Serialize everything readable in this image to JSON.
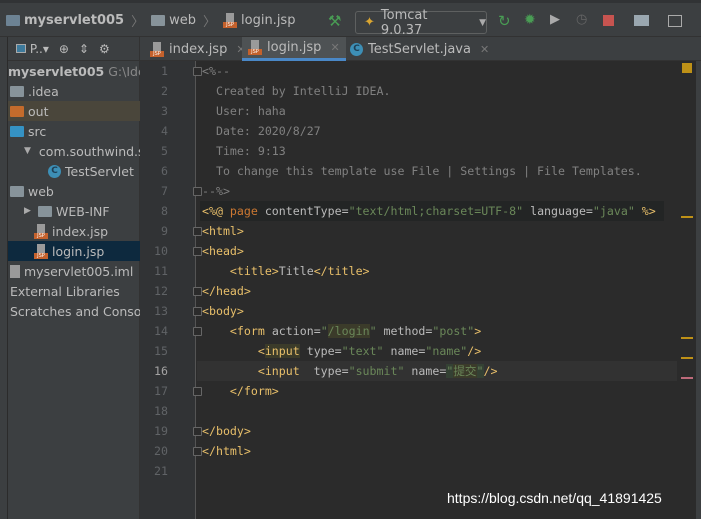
{
  "breadcrumb": {
    "project": "myservlet005",
    "folder": "web",
    "file": "login.jsp"
  },
  "toolbar": {
    "run_config": "Tomcat 9.0.37",
    "icons": [
      "build-hammer-icon",
      "rerun-icon",
      "debug-icon",
      "coverage-icon",
      "profile-icon",
      "stop-icon",
      "project-structure-icon",
      "terminal-icon"
    ],
    "stop_color": "#c75450",
    "run_color": "#499c54"
  },
  "sidebar": {
    "view_label": "P..",
    "project_root": "myservlet005",
    "project_path": "G:\\Idea",
    "items": [
      {
        "label": ".idea",
        "icon": "folder",
        "indent": 0
      },
      {
        "label": "out",
        "icon": "folder-orange",
        "indent": 0
      },
      {
        "label": "src",
        "icon": "folder-blue",
        "indent": 0
      },
      {
        "label": "com.southwind.s",
        "icon": "package",
        "indent": 1,
        "arrow": "▼"
      },
      {
        "label": "TestServlet",
        "icon": "class",
        "indent": 2
      },
      {
        "label": "web",
        "icon": "web-folder",
        "indent": 0
      },
      {
        "label": "WEB-INF",
        "icon": "folder",
        "indent": 1,
        "arrow": "▶"
      },
      {
        "label": "index.jsp",
        "icon": "jsp",
        "indent": 1
      },
      {
        "label": "login.jsp",
        "icon": "jsp",
        "indent": 1,
        "selected": true
      },
      {
        "label": "myservlet005.iml",
        "icon": "iml",
        "indent": 0
      },
      {
        "label": "External Libraries",
        "icon": "",
        "indent": 0
      },
      {
        "label": "Scratches and Console",
        "icon": "",
        "indent": 0
      }
    ]
  },
  "tabs": [
    {
      "label": "index.jsp",
      "icon": "jsp"
    },
    {
      "label": "login.jsp",
      "icon": "jsp",
      "active": true
    },
    {
      "label": "TestServlet.java",
      "icon": "class"
    }
  ],
  "editor": {
    "current_line": 16,
    "lines": [
      [
        {
          "t": "<%--",
          "c": "comment"
        }
      ],
      [
        {
          "t": "  Created by IntelliJ IDEA.",
          "c": "comment"
        }
      ],
      [
        {
          "t": "  User: haha",
          "c": "comment"
        }
      ],
      [
        {
          "t": "  Date: 2020/8/27",
          "c": "comment"
        }
      ],
      [
        {
          "t": "  Time: 9:13",
          "c": "comment"
        }
      ],
      [
        {
          "t": "  To change this template use File | Settings | File Templates.",
          "c": "comment"
        }
      ],
      [
        {
          "t": "--%>",
          "c": "comment"
        }
      ],
      [
        {
          "t": "<%@ ",
          "c": "dir"
        },
        {
          "t": "page ",
          "c": "kw"
        },
        {
          "t": "contentType=",
          "c": "attr"
        },
        {
          "t": "\"text/html;charset=UTF-8\"",
          "c": "str"
        },
        {
          "t": " language=",
          "c": "attr"
        },
        {
          "t": "\"java\"",
          "c": "str"
        },
        {
          "t": " %>",
          "c": "dir"
        }
      ],
      [
        {
          "t": "<html>",
          "c": "tag"
        }
      ],
      [
        {
          "t": "<head>",
          "c": "tag"
        }
      ],
      [
        {
          "t": "    <title>",
          "c": "tag"
        },
        {
          "t": "Title",
          "c": "attr"
        },
        {
          "t": "</title>",
          "c": "tag"
        }
      ],
      [
        {
          "t": "</head>",
          "c": "tag"
        }
      ],
      [
        {
          "t": "<body>",
          "c": "tag"
        }
      ],
      [
        {
          "t": "    <form ",
          "c": "tag"
        },
        {
          "t": "action=",
          "c": "attr"
        },
        {
          "t": "\"",
          "c": "str"
        },
        {
          "t": "/login",
          "c": "str hl"
        },
        {
          "t": "\"",
          "c": "str"
        },
        {
          "t": " method=",
          "c": "attr"
        },
        {
          "t": "\"post\"",
          "c": "str"
        },
        {
          "t": ">",
          "c": "tag"
        }
      ],
      [
        {
          "t": "        <",
          "c": "tag"
        },
        {
          "t": "input",
          "c": "tag hl"
        },
        {
          "t": " type=",
          "c": "attr"
        },
        {
          "t": "\"text\"",
          "c": "str"
        },
        {
          "t": " name=",
          "c": "attr"
        },
        {
          "t": "\"name\"",
          "c": "str"
        },
        {
          "t": "/>",
          "c": "tag"
        }
      ],
      [
        {
          "t": "        <input ",
          "c": "tag"
        },
        {
          "t": " type=",
          "c": "attr"
        },
        {
          "t": "\"submit\"",
          "c": "str"
        },
        {
          "t": " name=",
          "c": "attr"
        },
        {
          "t": "\"",
          "c": "str hlb"
        },
        {
          "t": "提交",
          "c": "str hl"
        },
        {
          "t": "\"",
          "c": "str hlb"
        },
        {
          "t": "/>",
          "c": "tag"
        }
      ],
      [
        {
          "t": "    </form>",
          "c": "tag"
        }
      ],
      [
        {
          "t": "",
          "c": "attr"
        }
      ],
      [
        {
          "t": "</body>",
          "c": "tag"
        }
      ],
      [
        {
          "t": "</html>",
          "c": "tag"
        }
      ],
      [
        {
          "t": "",
          "c": "attr"
        }
      ]
    ],
    "fold_lines": [
      1,
      7,
      9,
      10,
      12,
      13,
      14,
      17,
      19,
      20
    ]
  },
  "watermark": "https://blog.csdn.net/qq_41891425"
}
